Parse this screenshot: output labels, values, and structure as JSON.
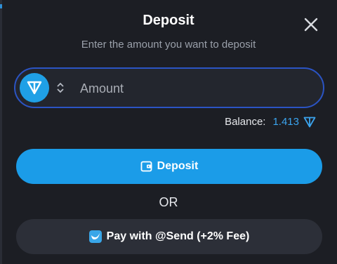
{
  "dialog": {
    "title": "Deposit",
    "subtitle": "Enter the amount you want to deposit",
    "close_icon": "close-icon"
  },
  "amount": {
    "currency_icon": "ton-logo-icon",
    "selector_icon": "chevron-up-down-icon",
    "placeholder": "Amount",
    "value": ""
  },
  "balance": {
    "label": "Balance:",
    "value": "1.413",
    "icon": "ton-icon"
  },
  "actions": {
    "deposit_label": "Deposit",
    "deposit_icon": "wallet-icon",
    "or_label": "OR",
    "send_label": "Pay with @Send (+2% Fee)",
    "send_icon": "send-bird-icon"
  },
  "colors": {
    "background": "#1c1e24",
    "accent": "#1b9ce8",
    "input_border": "#2b54c4",
    "secondary_button": "#2c2f38"
  }
}
